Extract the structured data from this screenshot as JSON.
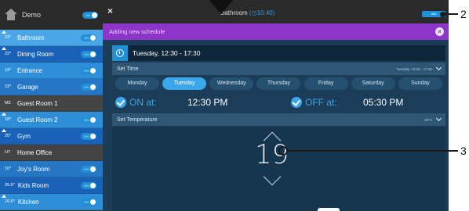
{
  "sidebar": {
    "header": {
      "title": "Demo",
      "sub": "",
      "toggle": "ON"
    },
    "rooms": [
      {
        "badge": "22°",
        "name": "Bathroom",
        "toggle": "ON",
        "style": "selected",
        "tri": true
      },
      {
        "badge": "22°",
        "name": "Dining Room",
        "toggle": "ON",
        "style": "blue",
        "tri": true
      },
      {
        "badge": "19°",
        "name": "Entrance",
        "toggle": "ON",
        "style": "blue-light",
        "tri": false
      },
      {
        "badge": "23°",
        "name": "Garage",
        "toggle": "ON",
        "style": "blue-mid",
        "tri": false
      },
      {
        "badge": "M2",
        "name": "Guest Room 1",
        "toggle": "",
        "style": "gray",
        "tri": false
      },
      {
        "badge": "18°",
        "name": "Guest Room 2",
        "toggle": "ON",
        "style": "blue-light",
        "tri": true
      },
      {
        "badge": "25°",
        "name": "Gym",
        "toggle": "ON",
        "style": "blue",
        "tri": true
      },
      {
        "badge": "H7",
        "name": "Home Office",
        "toggle": "",
        "style": "gray",
        "tri": false
      },
      {
        "badge": "16°",
        "name": "Joy's Room",
        "toggle": "ON",
        "style": "blue-mid",
        "tri": false
      },
      {
        "badge": "26.6°",
        "name": "Kids Room",
        "toggle": "ON",
        "style": "blue",
        "tri": false
      },
      {
        "badge": "16.6°",
        "name": "Kitchen",
        "toggle": "ON",
        "style": "blue-light",
        "tri": true
      }
    ]
  },
  "topbar": {
    "close": "×",
    "room": "Bathroom",
    "time": "10:40",
    "add_label": "add"
  },
  "banner": {
    "text": "Adding new schedule",
    "close": "×"
  },
  "schedule": {
    "text": "Tuesday, 12:30 - 17:30"
  },
  "set_time": {
    "label": "Set Time",
    "value": "Tuesday, 12:30 - 17:30"
  },
  "days": [
    {
      "label": "Monday",
      "active": false
    },
    {
      "label": "Tuesday",
      "active": true
    },
    {
      "label": "Wednesday",
      "active": false
    },
    {
      "label": "Thursday",
      "active": false
    },
    {
      "label": "Friday",
      "active": false
    },
    {
      "label": "Saturday",
      "active": false
    },
    {
      "label": "Sunday",
      "active": false
    }
  ],
  "on_off": {
    "on_label": "ON at:",
    "on_time": "12:30 PM",
    "off_label": "OFF at:",
    "off_time": "05:30 PM"
  },
  "set_temperature": {
    "label": "Set Temperature",
    "value": "19°C",
    "display": "19"
  },
  "callouts": {
    "two": "2",
    "three": "3"
  },
  "colors": {
    "accent": "#3aa7ea",
    "banner": "#8e35c9",
    "panel": "#1b3d57"
  }
}
